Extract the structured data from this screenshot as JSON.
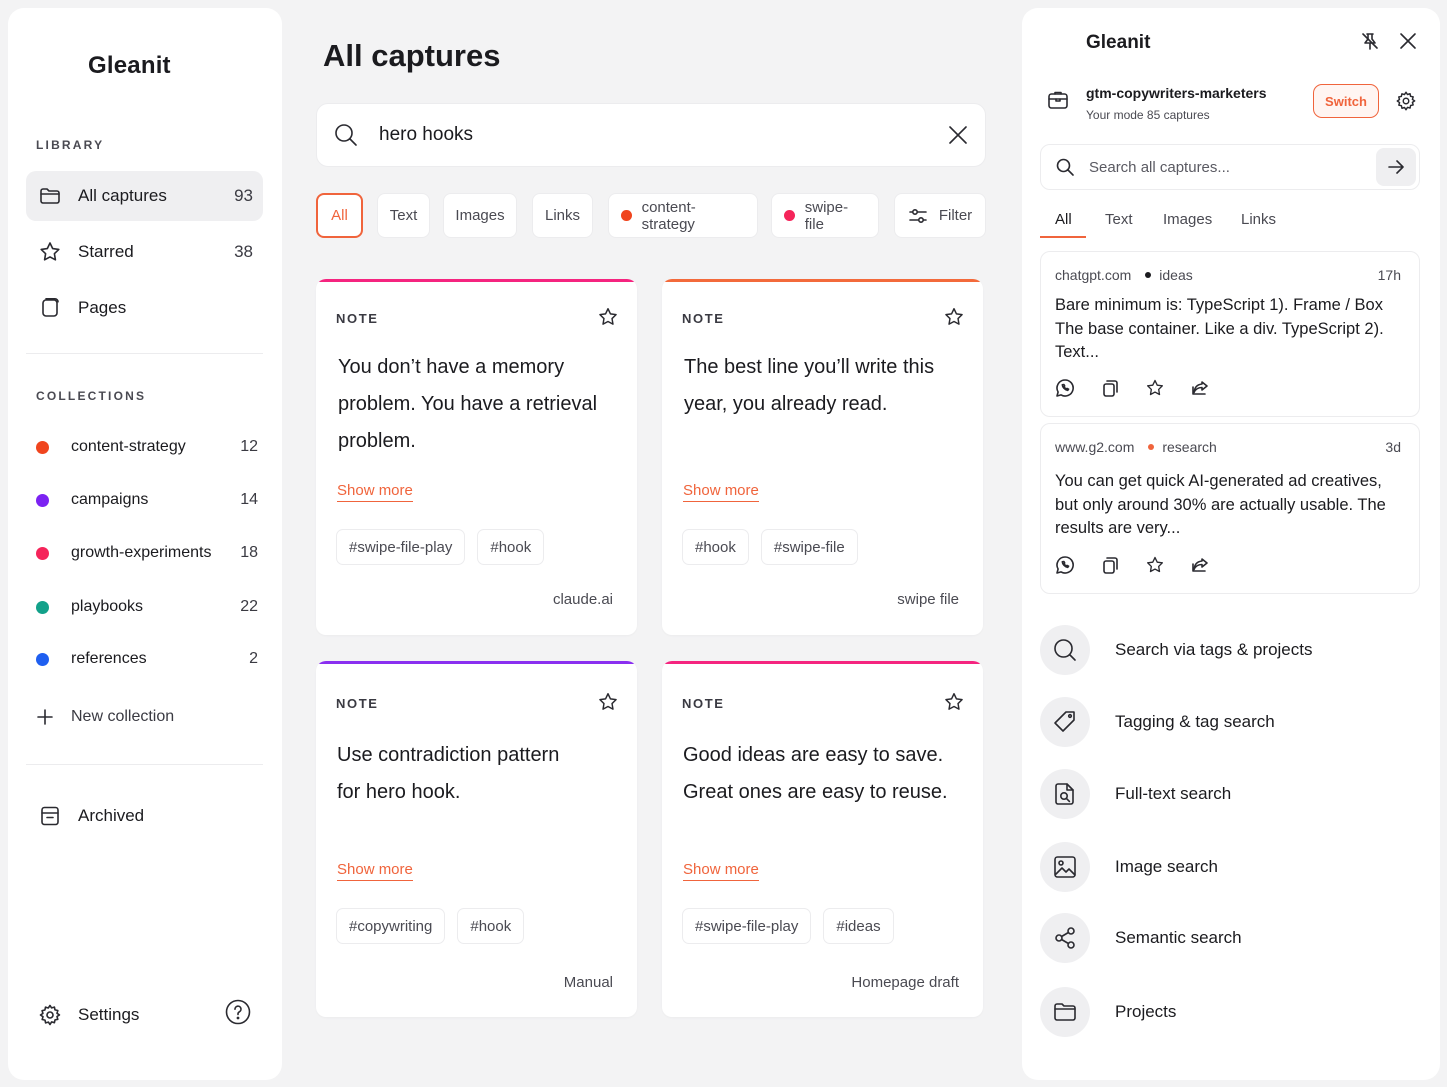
{
  "app": {
    "name": "Gleanit"
  },
  "sidebar": {
    "library_label": "LIBRARY",
    "nav": [
      {
        "label": "All captures",
        "count": "93",
        "icon": "folder-icon",
        "active": true
      },
      {
        "label": "Starred",
        "count": "38",
        "icon": "star-icon"
      },
      {
        "label": "Pages",
        "count": "",
        "icon": "pages-icon"
      }
    ],
    "collections_label": "COLLECTIONS",
    "collections": [
      {
        "label": "content-strategy",
        "count": "12",
        "color": "#f0451e"
      },
      {
        "label": "campaigns",
        "count": "14",
        "color": "#7b22f2"
      },
      {
        "label": "growth-experiments",
        "count": "18",
        "color": "#f5245a"
      },
      {
        "label": "playbooks",
        "count": "22",
        "color": "#13a18a"
      },
      {
        "label": "references",
        "count": "2",
        "color": "#1f5ff0"
      }
    ],
    "new_collection": "New collection",
    "archived": "Archived",
    "settings": "Settings"
  },
  "main": {
    "title": "All captures",
    "search_value": "hero hooks",
    "filters": [
      {
        "label": "All",
        "active": true
      },
      {
        "label": "Text"
      },
      {
        "label": "Images"
      },
      {
        "label": "Links"
      },
      {
        "label": "content-strategy",
        "dot": "#f0451e"
      },
      {
        "label": "swipe-file",
        "dot": "#f5245a"
      },
      {
        "label": "Filter",
        "icon": "sliders-icon"
      }
    ],
    "cards": [
      {
        "type": "NOTE",
        "accent": "#f5247f",
        "text": "You don’t have a memory problem. You have a retrieval problem.",
        "more": "Show more",
        "tags": [
          "#swipe-file-play",
          "#hook"
        ],
        "source": "claude.ai"
      },
      {
        "type": "NOTE",
        "accent": "#f36a3b",
        "text": "The best line you’ll write this year, you already read.",
        "more": "Show more",
        "tags": [
          "#hook",
          "#swipe-file"
        ],
        "source": "swipe file"
      },
      {
        "type": "NOTE",
        "accent": "#8a2ff0",
        "text": "Use contradiction pattern for hero hook.",
        "more": "Show more",
        "tags": [
          "#copywriting",
          "#hook"
        ],
        "source": "Manual"
      },
      {
        "type": "NOTE",
        "accent": "#f5247f",
        "text": "Good ideas are easy to save. Great ones are easy to reuse.",
        "more": "Show more",
        "tags": [
          "#swipe-file-play",
          "#ideas"
        ],
        "source": "Homepage draft"
      }
    ]
  },
  "panel": {
    "title": "Gleanit",
    "workspace": {
      "name": "gtm-copywriters-marketers",
      "sub": "Your mode 85 captures"
    },
    "switch_label": "Switch",
    "search_placeholder": "Search all captures...",
    "tabs": [
      "All",
      "Text",
      "Images",
      "Links"
    ],
    "captures": [
      {
        "source": "chatgpt.com",
        "tag": "ideas",
        "tag_color": "#1b1b1f",
        "time": "17h",
        "text": "Bare minimum is: TypeScript 1). Frame / Box The base container. Like a div. TypeScript 2). Text..."
      },
      {
        "source": "www.g2.com",
        "tag": "research",
        "tag_color": "#f0643c",
        "time": "3d",
        "text": "You can get quick AI-generated ad creatives, but only around 30% are actually usable. The results are very..."
      }
    ],
    "features": [
      {
        "label": "Search via tags & projects",
        "icon": "search-icon"
      },
      {
        "label": "Tagging & tag search",
        "icon": "tag-icon"
      },
      {
        "label": "Full-text search",
        "icon": "document-search-icon"
      },
      {
        "label": "Image search",
        "icon": "image-icon"
      },
      {
        "label": "Semantic search",
        "icon": "share-nodes-icon"
      },
      {
        "label": "Projects",
        "icon": "folder-icon"
      }
    ]
  },
  "colors": {
    "accent": "#f0643c"
  }
}
